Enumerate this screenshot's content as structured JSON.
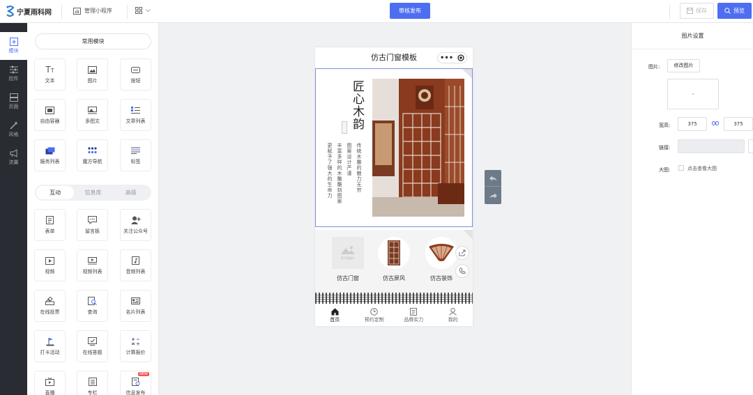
{
  "brand": {
    "name": "宁夏雨科网"
  },
  "topbar": {
    "manage_label": "管理小程序",
    "publish_label": "审核发布",
    "save_label": "保存",
    "preview_label": "预览"
  },
  "left_nav": [
    {
      "label": "模块",
      "icon": "plus-square-icon",
      "active": true
    },
    {
      "label": "控件",
      "icon": "sliders-icon"
    },
    {
      "label": "页面",
      "icon": "pages-icon"
    },
    {
      "label": "风格",
      "icon": "magic-wand-icon"
    },
    {
      "label": "流量",
      "icon": "megaphone-icon"
    }
  ],
  "panel": {
    "common_title": "常用模块",
    "common_modules": [
      {
        "label": "文本",
        "icon": "text-icon"
      },
      {
        "label": "图片",
        "icon": "image-icon"
      },
      {
        "label": "按钮",
        "icon": "button-icon"
      },
      {
        "label": "自由容器",
        "icon": "container-icon"
      },
      {
        "label": "多图文",
        "icon": "multi-image-icon"
      },
      {
        "label": "文章列表",
        "icon": "article-list-icon"
      },
      {
        "label": "服务列表",
        "icon": "service-list-icon"
      },
      {
        "label": "魔方导航",
        "icon": "cube-nav-icon"
      },
      {
        "label": "标签",
        "icon": "tag-icon"
      }
    ],
    "tabs": [
      "互动",
      "信息库",
      "高级"
    ],
    "active_tab": "互动",
    "interactive_modules": [
      {
        "label": "表单",
        "icon": "form-icon"
      },
      {
        "label": "留言板",
        "icon": "message-board-icon"
      },
      {
        "label": "关注公众号",
        "icon": "follow-icon"
      },
      {
        "label": "视频",
        "icon": "video-icon"
      },
      {
        "label": "视频列表",
        "icon": "video-list-icon"
      },
      {
        "label": "音频列表",
        "icon": "audio-list-icon"
      },
      {
        "label": "在线投票",
        "icon": "vote-icon"
      },
      {
        "label": "查询",
        "icon": "query-icon"
      },
      {
        "label": "名片列表",
        "icon": "card-list-icon"
      },
      {
        "label": "打卡活动",
        "icon": "checkin-flag-icon"
      },
      {
        "label": "在线答题",
        "icon": "quiz-icon"
      },
      {
        "label": "计算报价",
        "icon": "calculator-icon"
      },
      {
        "label": "直播",
        "icon": "live-icon"
      },
      {
        "label": "专栏",
        "icon": "column-icon"
      },
      {
        "label": "信息发布",
        "icon": "publish-info-icon",
        "badge": "NEW"
      }
    ]
  },
  "phone": {
    "title": "仿古门窗模板",
    "capsule_dots": "•••",
    "banner": {
      "headline": "匠心木韵",
      "poem_col1": "传统木雕的魅力无穷",
      "poem_col2": "图案设计严谨",
      "poem_col3": "丰富多样的木雕雕刻图案",
      "poem_col4": "更赋予了强大的生命力"
    },
    "categories": [
      {
        "label": "仿古门窗",
        "placeholder": "暂不能图片"
      },
      {
        "label": "仿古屏风"
      },
      {
        "label": "仿古装饰"
      }
    ],
    "tabbar": [
      {
        "label": "首页",
        "icon": "home-icon",
        "active": true
      },
      {
        "label": "预约定制",
        "icon": "clock-icon"
      },
      {
        "label": "品牌实力",
        "icon": "document-icon"
      },
      {
        "label": "我的",
        "icon": "user-icon"
      }
    ]
  },
  "right_panel": {
    "title": "图片设置",
    "image_label": "图片:",
    "change_image": "修改图片",
    "size_label": "宽高:",
    "width": "375",
    "height": "375",
    "link_label": "链接:",
    "zoom_label": "大图:",
    "zoom_option": "点击查看大图"
  },
  "colors": {
    "accent": "#4e6ef2",
    "nav_bg": "#2a2c33"
  }
}
